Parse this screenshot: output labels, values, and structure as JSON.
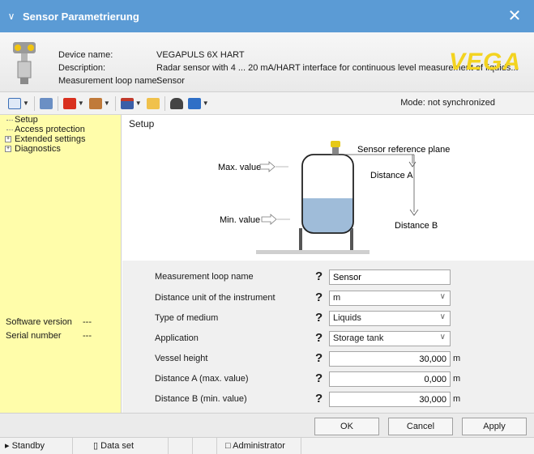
{
  "window": {
    "title": "Sensor Parametrierung"
  },
  "device": {
    "labels": {
      "name": "Device name:",
      "description": "Description:",
      "loop": "Measurement loop name:"
    },
    "name": "VEGAPULS 6X HART",
    "description": "Radar sensor with 4 ... 20 mA/HART interface for continuous level measurement of liquids...",
    "loop_name": "Sensor",
    "brand": "VEGA"
  },
  "toolbar": {
    "mode": "Mode: not synchronized"
  },
  "nav": {
    "tree": [
      {
        "label": "Setup",
        "expandable": false
      },
      {
        "label": "Access protection",
        "expandable": false
      },
      {
        "label": "Extended settings",
        "expandable": true
      },
      {
        "label": "Diagnostics",
        "expandable": true
      }
    ],
    "software_version_label": "Software version",
    "software_version_value": "---",
    "serial_number_label": "Serial number",
    "serial_number_value": "---"
  },
  "main": {
    "section_title": "Setup",
    "diagram": {
      "sensor_reference_plane": "Sensor reference plane",
      "distance_a": "Distance A",
      "distance_b": "Distance B",
      "max_value": "Max. value",
      "min_value": "Min. value"
    },
    "form": {
      "loop_name_label": "Measurement loop name",
      "loop_name_value": "Sensor",
      "distance_unit_label": "Distance unit of the instrument",
      "distance_unit_value": "m",
      "medium_label": "Type of medium",
      "medium_value": "Liquids",
      "application_label": "Application",
      "application_value": "Storage tank",
      "vessel_height_label": "Vessel height",
      "vessel_height_value": "30,000",
      "distance_a_label": "Distance A (max. value)",
      "distance_a_value": "0,000",
      "distance_b_label": "Distance B (min. value)",
      "distance_b_value": "30,000",
      "unit": "m",
      "help_glyph": "?"
    }
  },
  "buttons": {
    "ok": "OK",
    "cancel": "Cancel",
    "apply": "Apply"
  },
  "status": {
    "state": "Standby",
    "dataset": "Data set",
    "user": "Administrator"
  }
}
